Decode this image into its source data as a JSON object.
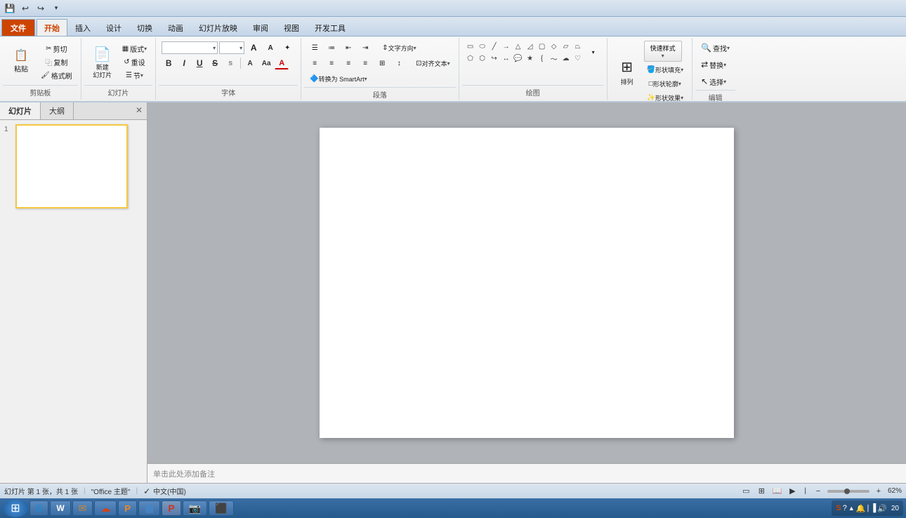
{
  "ribbon": {
    "tabs": [
      {
        "id": "file",
        "label": "文件",
        "active": false,
        "special": true
      },
      {
        "id": "home",
        "label": "开始",
        "active": true
      },
      {
        "id": "insert",
        "label": "插入"
      },
      {
        "id": "design",
        "label": "设计"
      },
      {
        "id": "transitions",
        "label": "切换"
      },
      {
        "id": "animations",
        "label": "动画"
      },
      {
        "id": "slideshow",
        "label": "幻灯片放映"
      },
      {
        "id": "review",
        "label": "审阅"
      },
      {
        "id": "view",
        "label": "视图"
      },
      {
        "id": "developer",
        "label": "开发工具"
      }
    ],
    "groups": {
      "clipboard": {
        "label": "剪贴板",
        "paste": "粘贴",
        "cut": "剪切",
        "copy": "复制",
        "format_painter": "格式刷"
      },
      "slides": {
        "label": "幻灯片",
        "new_slide": "新建\n幻灯片",
        "layout": "版式",
        "reset": "重设",
        "section": "节"
      },
      "font": {
        "label": "字体",
        "font_name": "",
        "font_size": "",
        "grow": "A",
        "shrink": "A",
        "clear": "♦",
        "bold": "B",
        "italic": "I",
        "underline": "U",
        "strike": "S",
        "shadow": "s",
        "char_space": "A",
        "case": "Aa",
        "font_color": "A"
      },
      "paragraph": {
        "label": "段落",
        "bullets": "≡",
        "numbers": "≡",
        "dec_indent": "⇤",
        "inc_indent": "⇥",
        "direction": "文字方向",
        "align_text": "对齐文本",
        "smart_art": "转换为 SmartArt",
        "align_left": "≡",
        "align_center": "≡",
        "align_right": "≡",
        "justify": "≡",
        "col_layout": "≡",
        "line_space": "≡"
      },
      "drawing": {
        "label": "绘图"
      },
      "arrange": {
        "label": "",
        "arrange": "排列",
        "quick_styles": "快速样式",
        "fill": "形状填充",
        "outline": "形状轮廓",
        "effect": "形状效果"
      },
      "editing": {
        "label": "编辑",
        "find": "查找",
        "replace": "替换",
        "select": "选择"
      }
    }
  },
  "quick_access": {
    "save": "💾",
    "undo": "↩",
    "redo": "↪",
    "customize": "▾"
  },
  "slide_panel": {
    "tabs": [
      {
        "label": "幻灯片",
        "active": true
      },
      {
        "label": "大纲"
      }
    ],
    "slides": [
      {
        "number": "1"
      }
    ]
  },
  "canvas": {
    "notes_placeholder": "单击此处添加备注"
  },
  "status_bar": {
    "slide_info": "幻灯片 第 1 张，共 1 张",
    "theme": "\"Office 主题\"",
    "language": "中文(中国)",
    "zoom": "62%"
  },
  "taskbar": {
    "start_icon": "⊞",
    "apps": [
      {
        "icon": "S",
        "label": "",
        "color": "#2288cc"
      },
      {
        "icon": "W",
        "label": "",
        "color": "#228844"
      },
      {
        "icon": "✉",
        "label": "",
        "color": "#cc6622"
      },
      {
        "icon": "☁",
        "label": "",
        "color": "#cc4422"
      },
      {
        "icon": "P",
        "label": "",
        "color": "#ee8822"
      },
      {
        "icon": "🔵",
        "label": "",
        "color": "#4466aa"
      },
      {
        "icon": "▶",
        "label": "",
        "color": "#cc3322"
      },
      {
        "icon": "📷",
        "label": "",
        "color": "#cc3344"
      },
      {
        "icon": "⬛",
        "label": "",
        "color": "#333333"
      }
    ],
    "tray": {
      "time": "20"
    }
  }
}
